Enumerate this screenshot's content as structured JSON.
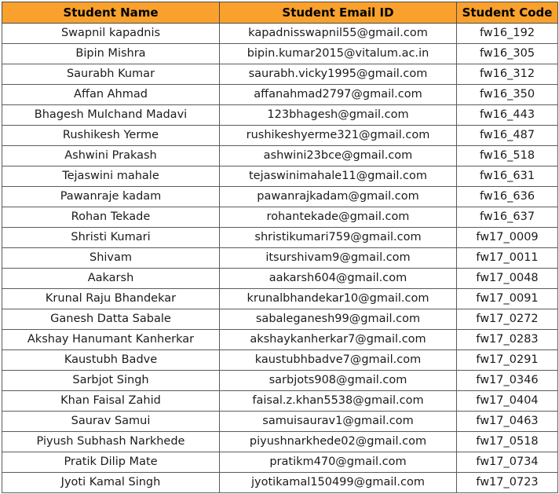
{
  "table": {
    "headers": {
      "name": "Student Name",
      "email": "Student Email ID",
      "code": "Student Code"
    },
    "header_color": "#f9a12c",
    "rows": [
      {
        "name": "Swapnil kapadnis",
        "email": "kapadnisswapnil55@gmail.com",
        "code": "fw16_192"
      },
      {
        "name": "Bipin Mishra",
        "email": "bipin.kumar2015@vitalum.ac.in",
        "code": "fw16_305"
      },
      {
        "name": "Saurabh Kumar",
        "email": "saurabh.vicky1995@gmail.com",
        "code": "fw16_312"
      },
      {
        "name": "Affan Ahmad",
        "email": "affanahmad2797@gmail.com",
        "code": "fw16_350"
      },
      {
        "name": "Bhagesh Mulchand Madavi",
        "email": "123bhagesh@gmail.com",
        "code": "fw16_443"
      },
      {
        "name": "Rushikesh Yerme",
        "email": "rushikeshyerme321@gmail.com",
        "code": "fw16_487"
      },
      {
        "name": "Ashwini Prakash",
        "email": "ashwini23bce@gmail.com",
        "code": "fw16_518"
      },
      {
        "name": "Tejaswini mahale",
        "email": "tejaswinimahale11@gmail.com",
        "code": "fw16_631"
      },
      {
        "name": "Pawanraje kadam",
        "email": "pawanrajkadam@gmail.com",
        "code": "fw16_636"
      },
      {
        "name": "Rohan Tekade",
        "email": "rohantekade@gmail.com",
        "code": "fw16_637"
      },
      {
        "name": "Shristi Kumari",
        "email": "shristikumari759@gmail.com",
        "code": "fw17_0009"
      },
      {
        "name": "Shivam",
        "email": "itsurshivam9@gmail.com",
        "code": "fw17_0011"
      },
      {
        "name": "Aakarsh",
        "email": "aakarsh604@gmail.com",
        "code": "fw17_0048"
      },
      {
        "name": "Krunal Raju Bhandekar",
        "email": "krunalbhandekar10@gmail.com",
        "code": "fw17_0091"
      },
      {
        "name": "Ganesh Datta Sabale",
        "email": "sabaleganesh99@gmail.com",
        "code": "fw17_0272"
      },
      {
        "name": "Akshay Hanumant Kanherkar",
        "email": "akshaykanherkar7@gmail.com",
        "code": "fw17_0283"
      },
      {
        "name": "Kaustubh Badve",
        "email": "kaustubhbadve7@gmail.com",
        "code": "fw17_0291"
      },
      {
        "name": "Sarbjot Singh",
        "email": "sarbjots908@gmail.com",
        "code": "fw17_0346"
      },
      {
        "name": "Khan Faisal Zahid",
        "email": "faisal.z.khan5538@gmail.com",
        "code": "fw17_0404"
      },
      {
        "name": "Saurav Samui",
        "email": "samuisaurav1@gmail.com",
        "code": "fw17_0463"
      },
      {
        "name": "Piyush Subhash Narkhede",
        "email": "piyushnarkhede02@gmail.com",
        "code": "fw17_0518"
      },
      {
        "name": "Pratik Dilip Mate",
        "email": "pratikm470@gmail.com",
        "code": "fw17_0734"
      },
      {
        "name": "Jyoti Kamal Singh",
        "email": "jyotikamal150499@gmail.com",
        "code": "fw17_0723"
      }
    ]
  }
}
